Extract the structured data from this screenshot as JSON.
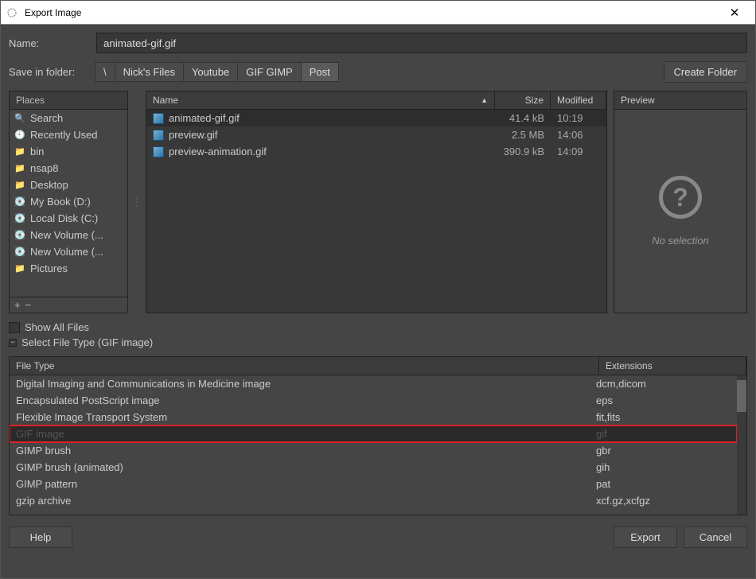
{
  "titlebar": {
    "title": "Export Image"
  },
  "name": {
    "label": "Name:",
    "value": "animated-gif.gif"
  },
  "savein": {
    "label": "Save in folder:",
    "crumbs": [
      "\\",
      "Nick's Files",
      "Youtube",
      "GIF GIMP",
      "Post"
    ],
    "activeIndex": 4,
    "createFolder": "Create Folder"
  },
  "places": {
    "header": "Places",
    "items": [
      {
        "icon": "🔍",
        "label": "Search"
      },
      {
        "icon": "🕘",
        "label": "Recently Used"
      },
      {
        "icon": "📁",
        "label": "bin"
      },
      {
        "icon": "📁",
        "label": "nsap8"
      },
      {
        "icon": "📁",
        "label": "Desktop"
      },
      {
        "icon": "💽",
        "label": "My Book (D:)"
      },
      {
        "icon": "💽",
        "label": "Local Disk (C:)"
      },
      {
        "icon": "💽",
        "label": "New Volume (..."
      },
      {
        "icon": "💽",
        "label": "New Volume (..."
      },
      {
        "icon": "📁",
        "label": "Pictures"
      }
    ],
    "add": "+",
    "remove": "−"
  },
  "filelist": {
    "headers": {
      "name": "Name",
      "size": "Size",
      "modified": "Modified"
    },
    "rows": [
      {
        "name": "animated-gif.gif",
        "size": "41.4 kB",
        "modified": "10:19",
        "selected": true
      },
      {
        "name": "preview.gif",
        "size": "2.5 MB",
        "modified": "14:06",
        "selected": false
      },
      {
        "name": "preview-animation.gif",
        "size": "390.9 kB",
        "modified": "14:09",
        "selected": false
      }
    ]
  },
  "preview": {
    "header": "Preview",
    "noselection": "No selection"
  },
  "controls": {
    "showAll": "Show All Files",
    "selectType": "Select File Type (GIF image)"
  },
  "filetypes": {
    "headers": {
      "type": "File Type",
      "ext": "Extensions"
    },
    "rows": [
      {
        "type": "Digital Imaging and Communications in Medicine image",
        "ext": "dcm,dicom"
      },
      {
        "type": "Encapsulated PostScript image",
        "ext": "eps"
      },
      {
        "type": "Flexible Image Transport System",
        "ext": "fit,fits"
      },
      {
        "type": "GIF image",
        "ext": "gif",
        "highlight": true
      },
      {
        "type": "GIMP brush",
        "ext": "gbr"
      },
      {
        "type": "GIMP brush (animated)",
        "ext": "gih"
      },
      {
        "type": "GIMP pattern",
        "ext": "pat"
      },
      {
        "type": "gzip archive",
        "ext": "xcf.gz,xcfgz"
      }
    ]
  },
  "buttons": {
    "help": "Help",
    "export": "Export",
    "cancel": "Cancel"
  }
}
